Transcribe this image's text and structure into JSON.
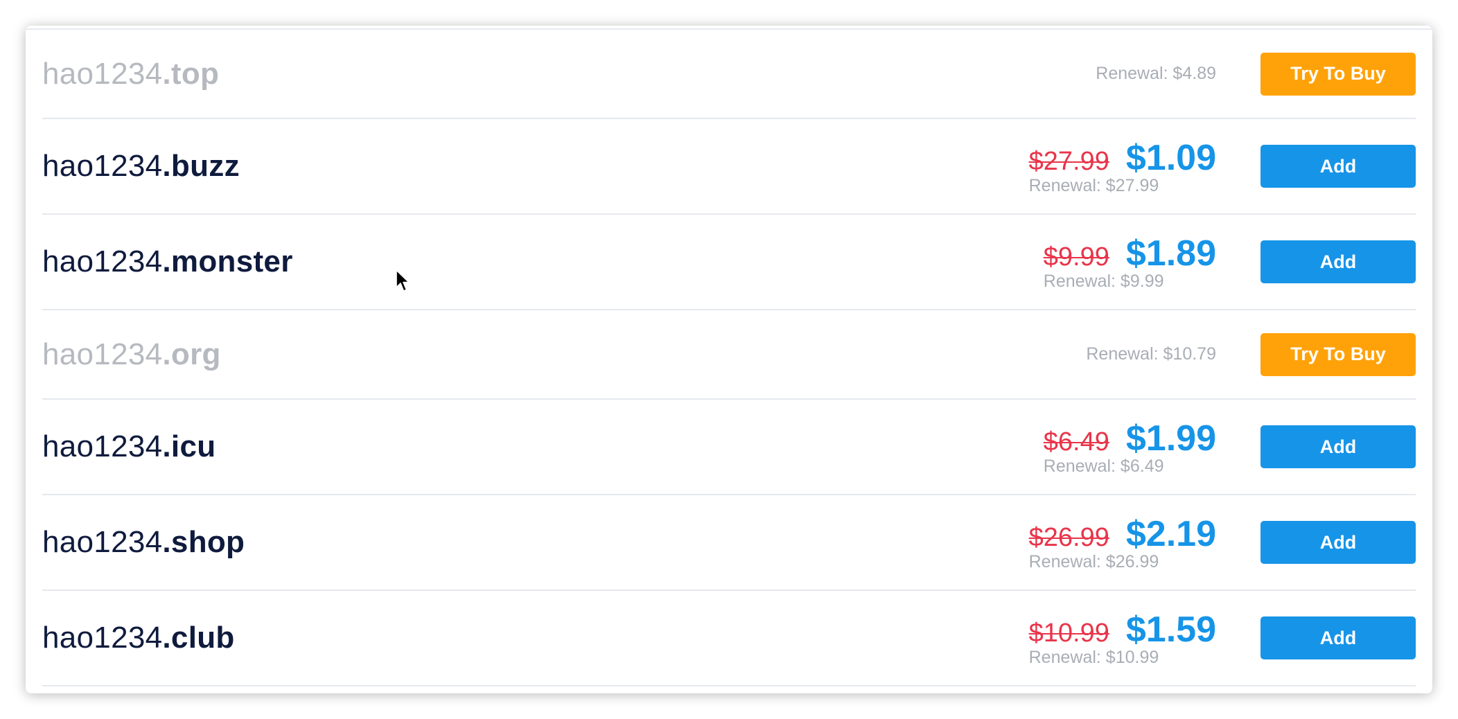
{
  "rows": [
    {
      "name": "hao1234",
      "tld": ".top",
      "status": "taken",
      "renewal": "Renewal: $4.89",
      "button": "Try To Buy"
    },
    {
      "name": "hao1234",
      "tld": ".buzz",
      "status": "available",
      "old_price": "$27.99",
      "price": "$1.09",
      "renewal": "Renewal: $27.99",
      "button": "Add"
    },
    {
      "name": "hao1234",
      "tld": ".monster",
      "status": "available",
      "old_price": "$9.99",
      "price": "$1.89",
      "renewal": "Renewal: $9.99",
      "button": "Add"
    },
    {
      "name": "hao1234",
      "tld": ".org",
      "status": "taken",
      "renewal": "Renewal: $10.79",
      "button": "Try To Buy"
    },
    {
      "name": "hao1234",
      "tld": ".icu",
      "status": "available",
      "old_price": "$6.49",
      "price": "$1.99",
      "renewal": "Renewal: $6.49",
      "button": "Add"
    },
    {
      "name": "hao1234",
      "tld": ".shop",
      "status": "available",
      "old_price": "$26.99",
      "price": "$2.19",
      "renewal": "Renewal: $26.99",
      "button": "Add"
    },
    {
      "name": "hao1234",
      "tld": ".club",
      "status": "available",
      "old_price": "$10.99",
      "price": "$1.59",
      "renewal": "Renewal: $10.99",
      "button": "Add"
    }
  ],
  "colors": {
    "add_button": "#1694e8",
    "try_button": "#ffa20a",
    "old_price": "#e8354a",
    "new_price": "#1694e8",
    "domain_text": "#0f1b3d",
    "taken_text": "#b6b9bf"
  },
  "icons": {
    "cursor": "mouse-pointer-icon"
  }
}
